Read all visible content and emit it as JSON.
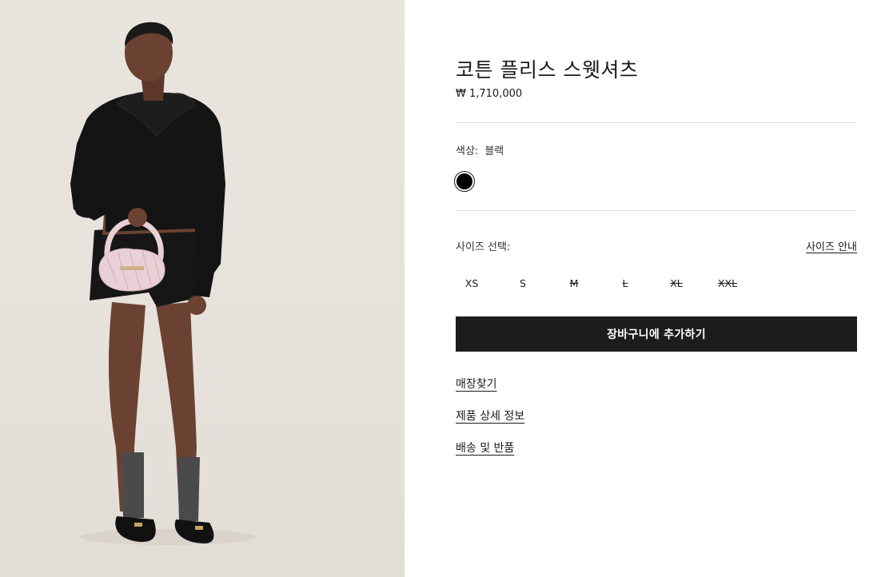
{
  "product": {
    "title": "코튼 플리스 스웻셔츠",
    "price": "₩ 1,710,000"
  },
  "color": {
    "label": "색상:",
    "selected_value": "블랙",
    "swatches": [
      {
        "name": "블랙",
        "hex": "#000000",
        "selected": true
      }
    ]
  },
  "size": {
    "label": "사이즈 선택:",
    "guide_link": "사이즈 안내",
    "options": [
      {
        "label": "XS",
        "available": true
      },
      {
        "label": "S",
        "available": true
      },
      {
        "label": "M",
        "available": false
      },
      {
        "label": "L",
        "available": false
      },
      {
        "label": "XL",
        "available": false
      },
      {
        "label": "XXL",
        "available": false
      }
    ]
  },
  "cart": {
    "add_label": "장바구니에 추가하기"
  },
  "links": {
    "store_finder": "매장찾기",
    "product_details": "제품 상세 정보",
    "shipping_returns": "배송 및 반품"
  },
  "image": {
    "alt": "model-wearing-black-sweatshirt-with-pink-bag"
  },
  "colors": {
    "button_bg": "#1c1c1c",
    "image_bg": "#e7e3dc",
    "divider": "#e2e2e2",
    "bag_pink": "#e9cfd6"
  }
}
